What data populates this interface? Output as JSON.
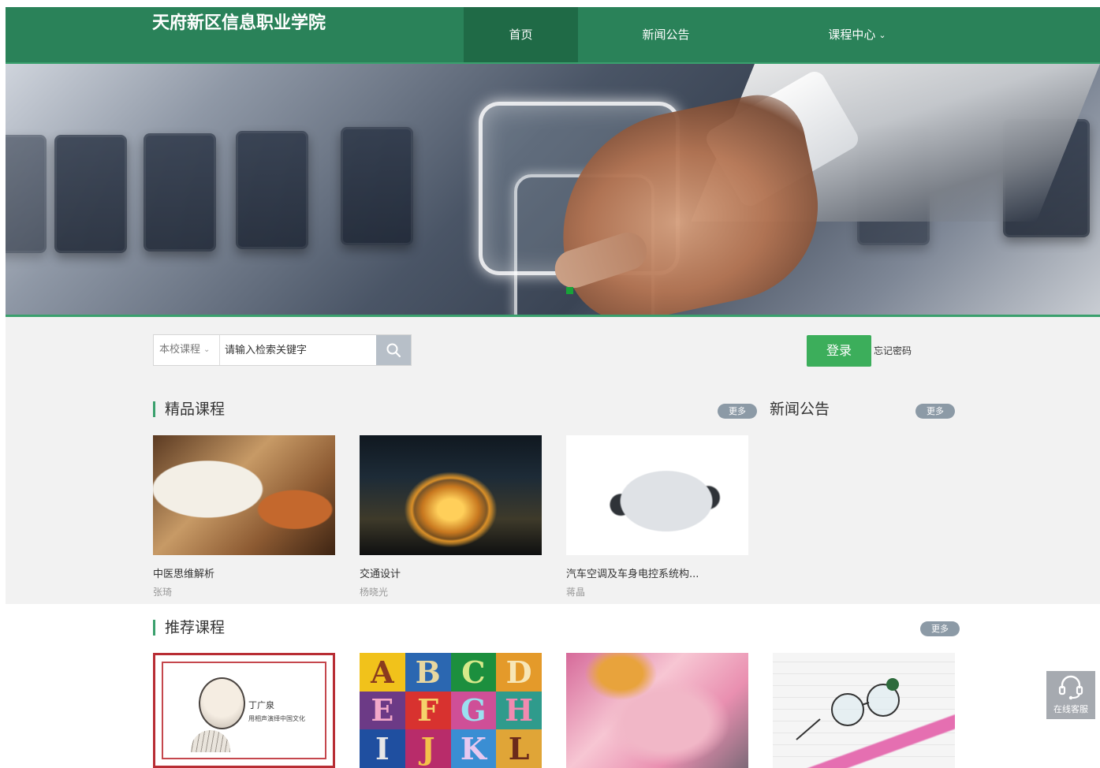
{
  "header": {
    "logo": "天府新区信息职业学院",
    "nav": [
      {
        "label": "首页",
        "active": true
      },
      {
        "label": "新闻公告",
        "active": false
      },
      {
        "label": "课程中心",
        "active": false,
        "has_dropdown": true
      }
    ]
  },
  "search": {
    "scope_selected": "本校课程",
    "placeholder": "请输入检索关键字"
  },
  "auth": {
    "login_label": "登录",
    "forgot_label": "忘记密码"
  },
  "featured": {
    "title": "精品课程",
    "more_label": "更多",
    "courses": [
      {
        "title": "中医思维解析",
        "teacher": "张琦"
      },
      {
        "title": "交通设计",
        "teacher": "杨晓光"
      },
      {
        "title": "汽车空调及车身电控系统构...",
        "teacher": "蒋晶"
      }
    ]
  },
  "news": {
    "title": "新闻公告",
    "more_label": "更多"
  },
  "recommended": {
    "title": "推荐课程",
    "more_label": "更多",
    "caricature_name": "丁广泉",
    "caricature_subtitle": "用相声演绎中国文化"
  },
  "letters": [
    "A",
    "B",
    "C",
    "D",
    "E",
    "F",
    "G",
    "H",
    "I",
    "J",
    "K",
    "L"
  ],
  "customer_service": {
    "label": "在线客服",
    "icon": "headset-icon"
  },
  "colors": {
    "header_green": "#2a8259",
    "active_nav": "#1f6a46",
    "login_green": "#3cae5b",
    "accent": "#3aa06d",
    "pill_gray": "#8c9aa6"
  }
}
